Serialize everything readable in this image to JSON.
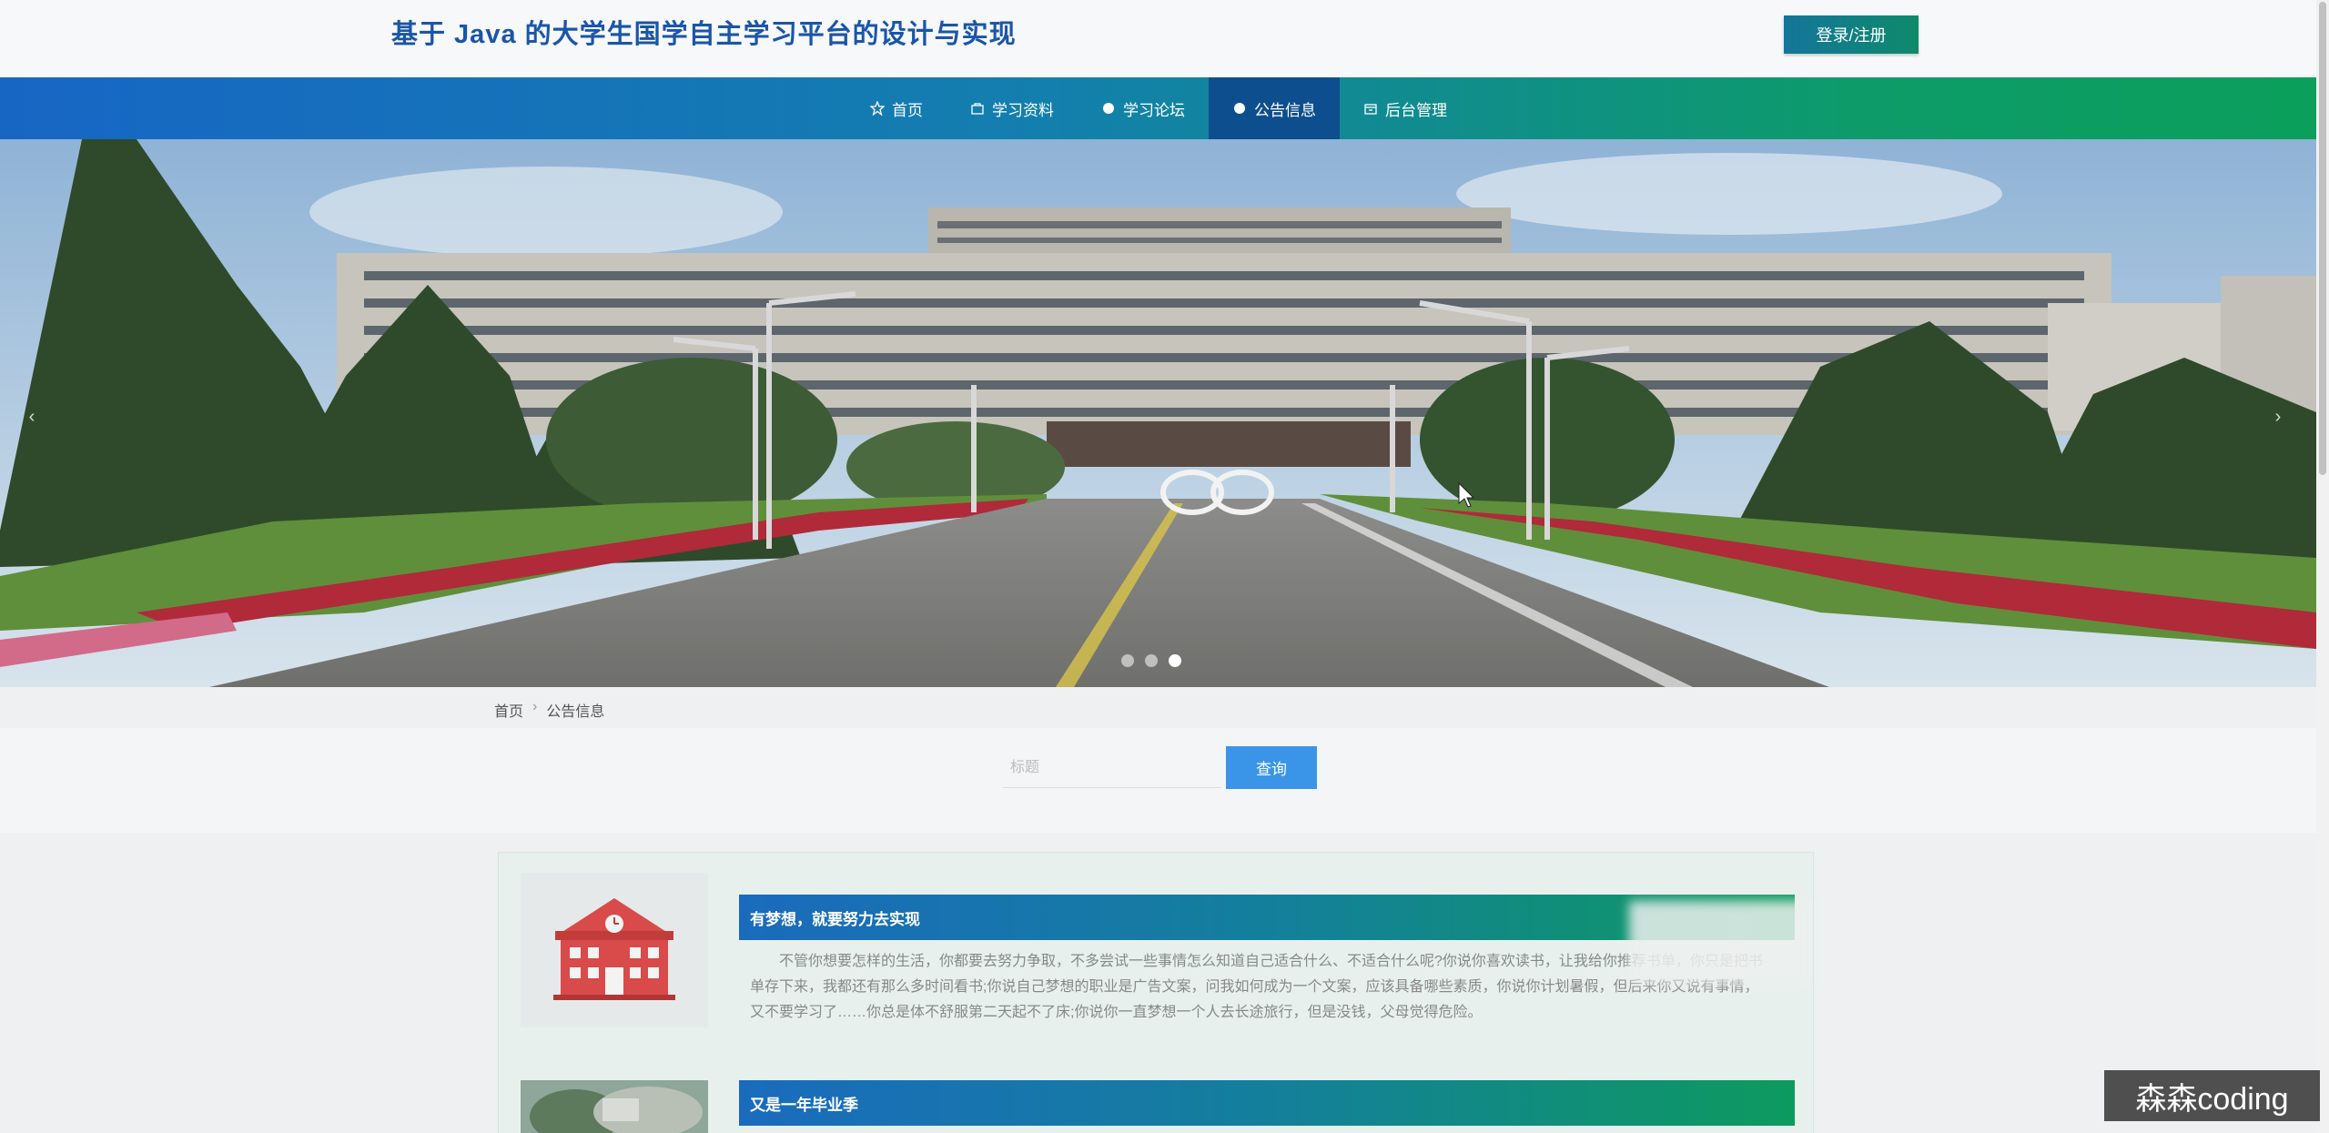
{
  "header": {
    "title": "基于 Java 的大学生国学自主学习平台的设计与实现",
    "login_label": "登录/注册"
  },
  "nav": {
    "items": [
      {
        "label": "首页",
        "icon": "star-icon"
      },
      {
        "label": "学习资料",
        "icon": "bag-icon"
      },
      {
        "label": "学习论坛",
        "icon": "circle-icon"
      },
      {
        "label": "公告信息",
        "icon": "circle-icon",
        "active": true
      },
      {
        "label": "后台管理",
        "icon": "box-icon"
      }
    ]
  },
  "banner": {
    "slide_count": 3,
    "active_slide": 3,
    "prev_arrow": "‹",
    "next_arrow": "›"
  },
  "breadcrumb": {
    "home": "首页",
    "separator": "›",
    "current": "公告信息"
  },
  "search": {
    "placeholder": "标题",
    "button_label": "查询"
  },
  "notices": [
    {
      "title": "有梦想，就要努力去实现",
      "text": "不管你想要怎样的生活，你都要去努力争取，不多尝试一些事情怎么知道自己适合什么、不适合什么呢?你说你喜欢读书，让我给你推荐书单，你只是把书单存下来，我都还有那么多时间看书;你说自己梦想的职业是广告文案，问我如何成为一个文案，应该具备哪些素质，你说你计划暑假，但后来你又说有事情，又不要学习了……你总是体不舒服第二天起不了床;你说你一直梦想一个人去长途旅行，但是没钱，父母觉得危险。"
    },
    {
      "title": "又是一年毕业季",
      "text": ""
    }
  ],
  "watermark": "森森coding",
  "colors": {
    "nav_start": "#1766c4",
    "nav_end": "#0b9f5b",
    "active_nav": "#0d4f8e",
    "search_button": "#3a95e8",
    "title": "#1a56a8"
  }
}
